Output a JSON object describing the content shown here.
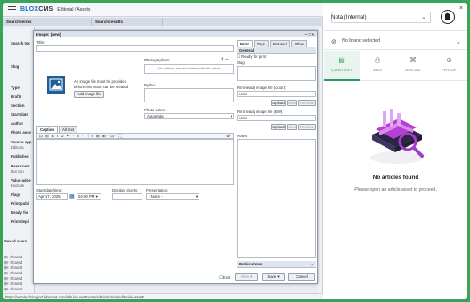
{
  "cms": {
    "logo_prefix": "BLOX",
    "logo_suffix": "CMS",
    "breadcrumb": "Editorial / Assets",
    "search_terms": "Search terms",
    "search_results": "Search results",
    "left_labels": [
      "Search tex",
      "Slug",
      "Type",
      "Drafts",
      "Section",
      "Start date",
      "Author",
      "Photo asse",
      "Source app",
      "Editoria",
      "Published",
      "User contr",
      "Not con",
      "Value-adde",
      "Exclude",
      "Flags",
      "Print publi",
      "Ready for",
      "Print depti",
      "Saved searc"
    ],
    "tree_items": [
      "Shared",
      "Shared",
      "Shared",
      "Shared",
      "Shared",
      "Shared",
      "Shared",
      "Shared by mbullard"
    ],
    "status_url": "https://admin-chicago2.bloxcms.com/wfs.lee.net/tncms/admin/action/editorial-asset#"
  },
  "dialog": {
    "title": "Image: (new)",
    "controls": "– □ ×",
    "title_label": "Title:",
    "image_hint": "An image file must be provided before this asset can be created",
    "add_image": "Add image file",
    "photographers_label": "Photographers:",
    "photographers_empty": "No authors are associated with this asset",
    "byline_label": "Byline:",
    "photo_sales_label": "Photo sales:",
    "photo_sales_value": "Automatic",
    "editor_tabs": [
      "Caption",
      "Alt text"
    ],
    "start_label": "Start date/time:",
    "start_date": "Apr 17, 2025",
    "start_time": "04:00 PM",
    "display_priority_label": "Display priority:",
    "presentation_label": "Presentation:",
    "presentation_value": "- None -",
    "right_tabs": [
      "Print",
      "Tags",
      "Related",
      "Other"
    ],
    "general": "General",
    "ready_for_print": "Ready for print",
    "slug_label": "Slug",
    "color_label": "Print-ready image file (color):",
    "bw_label": "Print ready image file (BW):",
    "none": "none",
    "upload": "Upload",
    "view": "View",
    "remove": "Remove",
    "notes_label": "Notes:",
    "publications": "Publications",
    "exit": "Exit",
    "view_btn": "View",
    "save_btn": "Save",
    "cancel_btn": "Cancel"
  },
  "panel": {
    "title": "Nota (Internal)",
    "brand": "No brand selected",
    "tabs": [
      "CONTENT",
      "SEO",
      "SOCIAL",
      "PROOF"
    ],
    "empty_title": "No articles found",
    "empty_sub": "Please open an article asset to proceed.",
    "accent": "#2e9b5b"
  }
}
